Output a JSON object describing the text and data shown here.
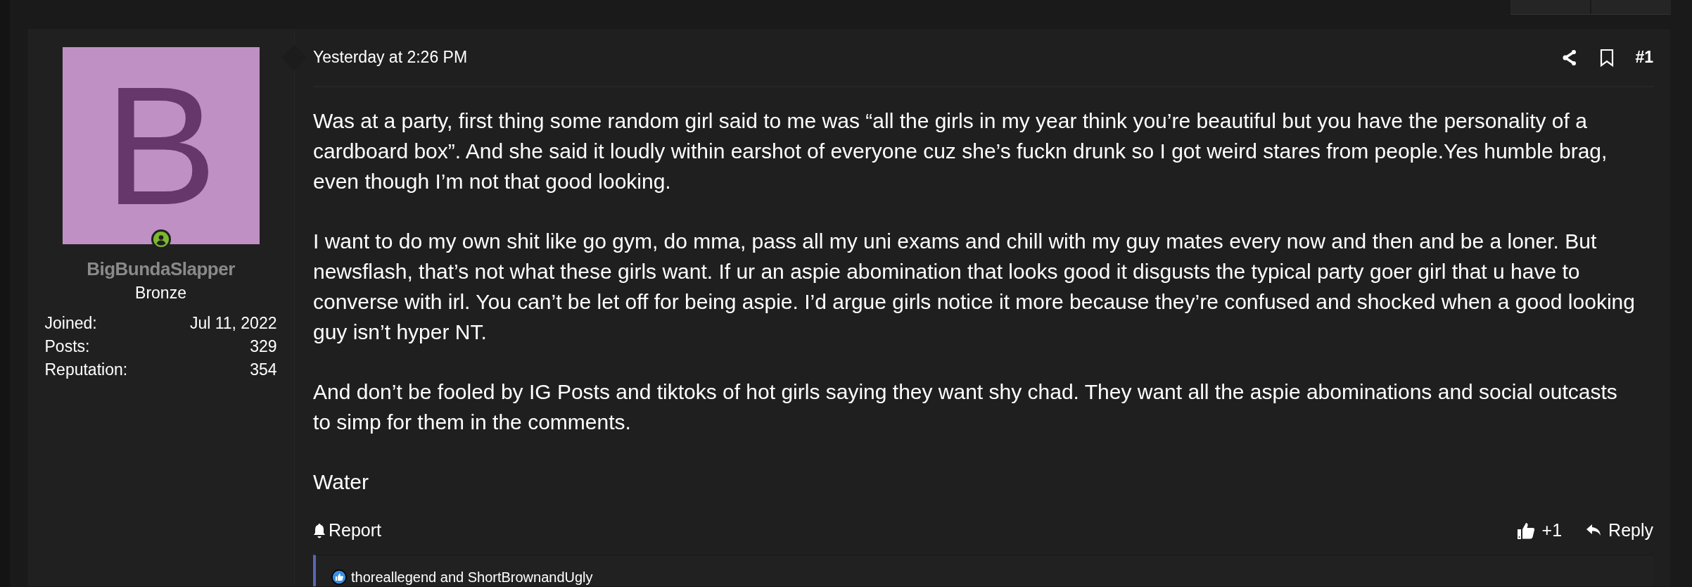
{
  "post": {
    "author": {
      "avatar_letter": "B",
      "name": "BigBundaSlapper",
      "rank": "Bronze",
      "online": true,
      "stats": [
        {
          "label": "Joined:",
          "value": "Jul 11, 2022"
        },
        {
          "label": "Posts:",
          "value": "329"
        },
        {
          "label": "Reputation:",
          "value": "354"
        }
      ]
    },
    "date": "Yesterday at 2:26 PM",
    "number": "#1",
    "paragraphs": [
      "Was at a party, first thing some random girl said to me was “all the girls in my year think you’re beautiful but you have the personality of a cardboard box”. And she said it loudly within earshot of everyone cuz she’s fuckn drunk so I got weird stares from people.Yes humble brag, even though I’m not that good looking.",
      "I want to do my own shit like go gym, do mma, pass all my uni exams and chill with my guy mates every now and then and be a loner. But newsflash, that’s not what these girls want. If ur an aspie abomination that looks good it disgusts the typical party goer girl that u have to converse with irl. You can’t be let off for being aspie. I’d argue girls notice it more because they’re confused and shocked when a good looking guy isn’t hyper NT.",
      "And don’t be fooled by IG Posts and tiktoks of hot girls saying they want shy chad. They want all the aspie abominations and social outcasts to simp for them in the comments.",
      "Water"
    ],
    "report": "Report",
    "like_count": "+1",
    "reply": "Reply",
    "reactions": "thoreallegend and ShortBrownandUgly"
  }
}
